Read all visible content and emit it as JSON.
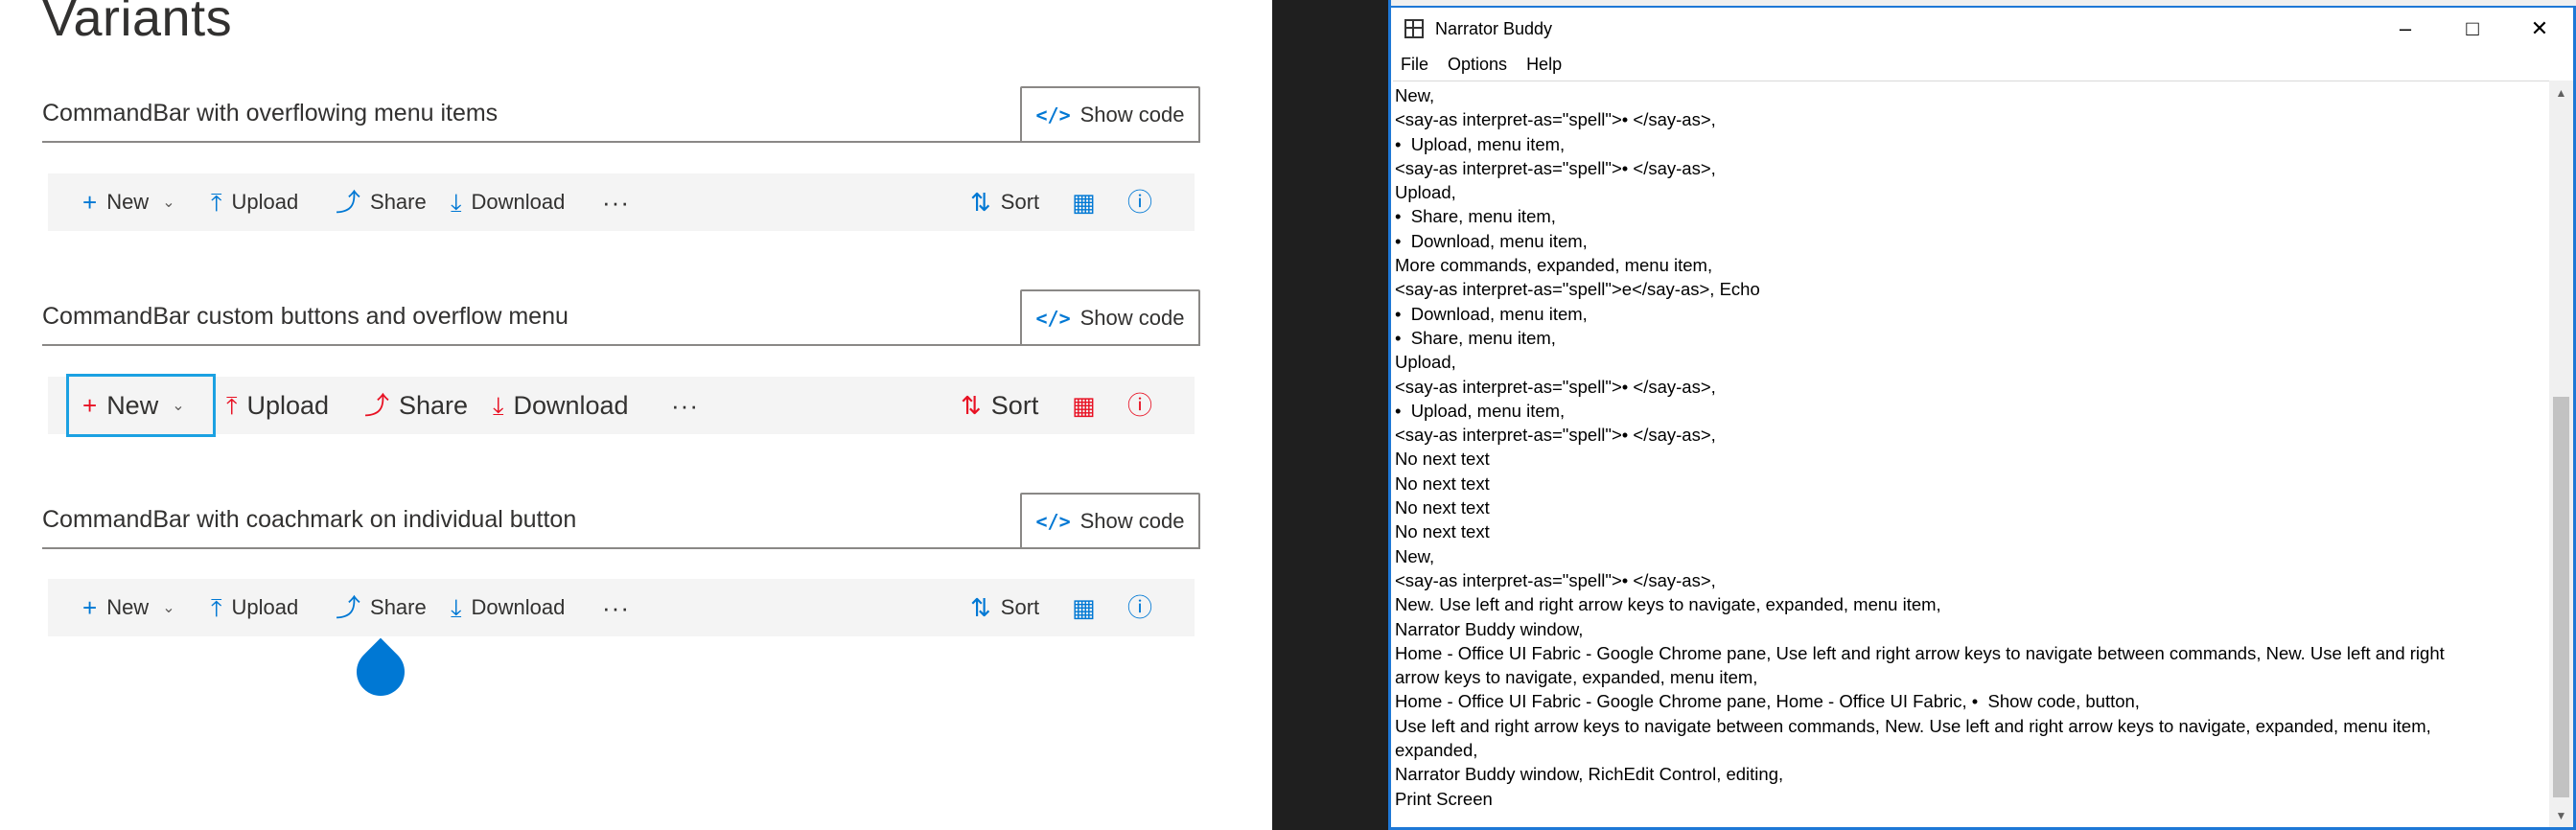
{
  "page": {
    "title": "Variants",
    "sections": [
      {
        "title": "CommandBar with overflowing menu items",
        "show_code": "Show code",
        "items": [
          "New",
          "Upload",
          "Share",
          "Download"
        ],
        "more": "···",
        "far_items": [
          "Sort"
        ]
      },
      {
        "title": "CommandBar custom buttons and overflow menu",
        "show_code": "Show code",
        "items": [
          "New",
          "Upload",
          "Share",
          "Download"
        ],
        "more": "···",
        "far_items": [
          "Sort"
        ]
      },
      {
        "title": "CommandBar with coachmark on individual button",
        "show_code": "Show code",
        "items": [
          "New",
          "Upload",
          "Share",
          "Download"
        ],
        "more": "···",
        "far_items": [
          "Sort"
        ]
      }
    ]
  },
  "icons": {
    "new": "plus-icon",
    "upload": "upload-icon",
    "share": "share-icon",
    "download": "download-icon",
    "more": "more-icon",
    "sort": "sort-icon",
    "view": "view-icon",
    "info": "info-icon",
    "code": "code-icon"
  },
  "colors": {
    "accent": "#0078d4",
    "custom_red": "#e81123",
    "focus": "#1ba1e2",
    "window_border": "#1e78d6"
  },
  "window": {
    "title": "Narrator Buddy",
    "menu": [
      "File",
      "Options",
      "Help"
    ],
    "lines": [
      "New,",
      "<say-as interpret-as=\"spell\">• </say-as>,",
      "•  Upload, menu item,",
      "<say-as interpret-as=\"spell\">• </say-as>,",
      "Upload,",
      "•  Share, menu item,",
      "•  Download, menu item,",
      "More commands, expanded, menu item,",
      "<say-as interpret-as=\"spell\">e</say-as>, Echo",
      "•  Download, menu item,",
      "•  Share, menu item,",
      "Upload,",
      "<say-as interpret-as=\"spell\">• </say-as>,",
      "•  Upload, menu item,",
      "<say-as interpret-as=\"spell\">• </say-as>,",
      "No next text",
      "No next text",
      "No next text",
      "No next text",
      "New,",
      "<say-as interpret-as=\"spell\">• </say-as>,",
      "New. Use left and right arrow keys to navigate, expanded, menu item,",
      "Narrator Buddy window,",
      "Home - Office UI Fabric - Google Chrome pane, Use left and right arrow keys to navigate between commands, New. Use left and right",
      "arrow keys to navigate, expanded, menu item,",
      "Home - Office UI Fabric - Google Chrome pane, Home - Office UI Fabric, •  Show code, button,",
      "Use left and right arrow keys to navigate between commands, New. Use left and right arrow keys to navigate, expanded, menu item,",
      "expanded,",
      "Narrator Buddy window, RichEdit Control, editing,",
      "Print Screen"
    ]
  }
}
